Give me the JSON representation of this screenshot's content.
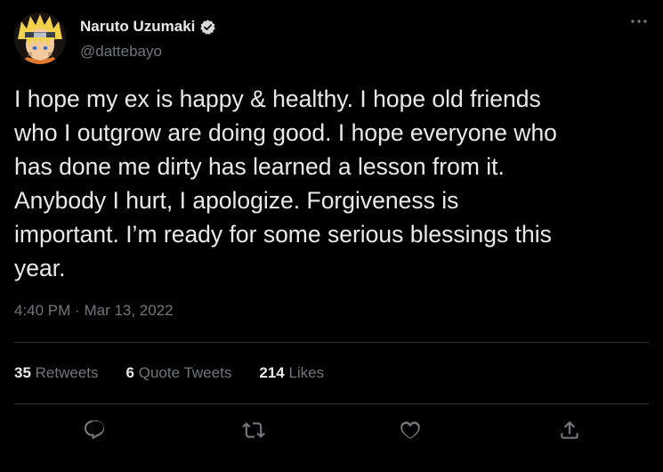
{
  "author": {
    "display_name": "Naruto Uzumaki",
    "handle": "@dattebayo",
    "verified": true,
    "avatar_icon": "naruto-avatar"
  },
  "tweet": {
    "lines": [
      "I hope my ex is happy & healthy. I hope old friends",
      "who I outgrow are doing good. I hope everyone who",
      "has done me dirty has learned a lesson from it.",
      "Anybody I hurt, I apologize. Forgiveness is",
      "important. I’m ready for some serious blessings this",
      "year."
    ],
    "time": "4:40 PM",
    "separator": "·",
    "date": "Mar 13, 2022"
  },
  "stats": {
    "retweets": {
      "count": "35",
      "label": "Retweets"
    },
    "quotes": {
      "count": "6",
      "label": "Quote Tweets"
    },
    "likes": {
      "count": "214",
      "label": "Likes"
    }
  },
  "actions": [
    {
      "name": "reply",
      "icon": "reply-icon"
    },
    {
      "name": "retweet",
      "icon": "retweet-icon"
    },
    {
      "name": "like",
      "icon": "heart-icon"
    },
    {
      "name": "share",
      "icon": "share-icon"
    }
  ],
  "colors": {
    "background": "#000000",
    "text_primary": "#e7e9ea",
    "text_secondary": "#71767b",
    "divider": "#2f3336",
    "verified_badge": "#d9d9d9"
  }
}
